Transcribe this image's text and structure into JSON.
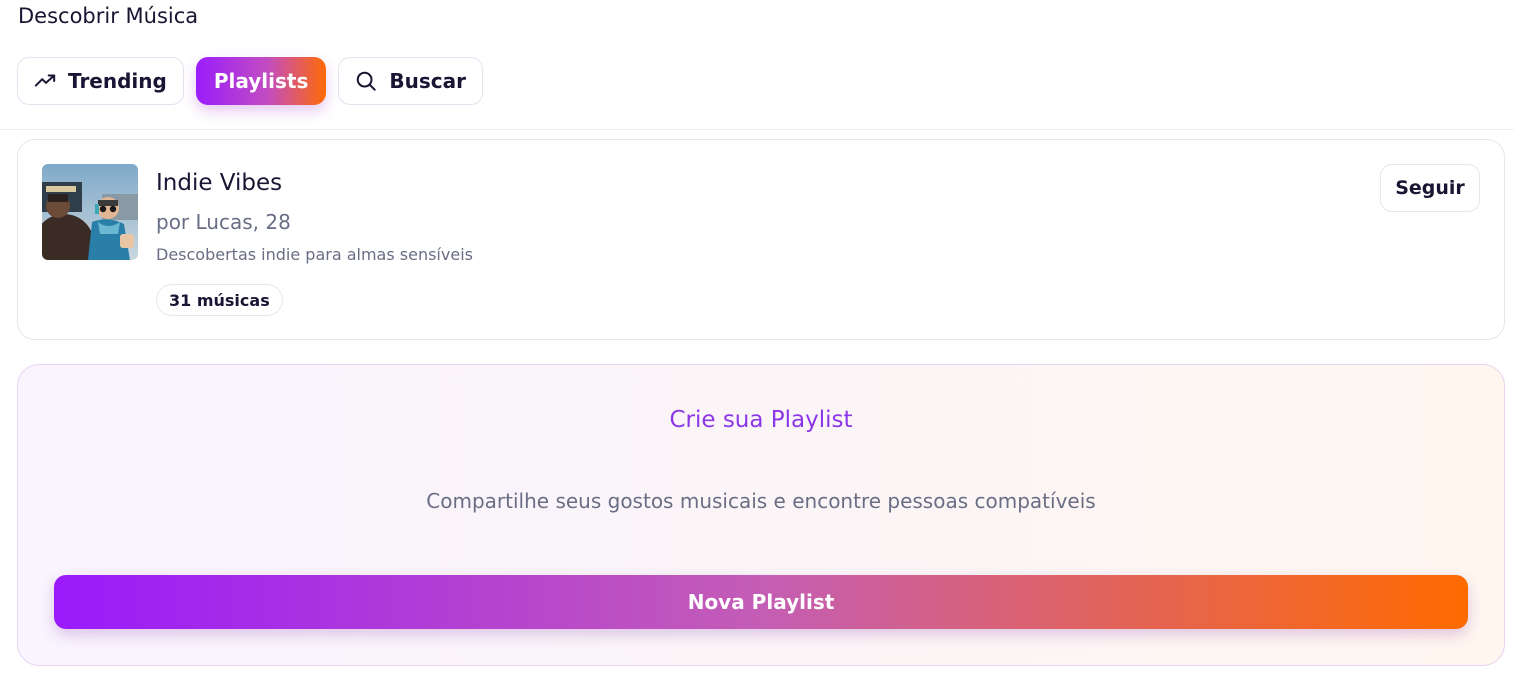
{
  "header": {
    "title": "Descobrir Música"
  },
  "tabs": [
    {
      "label": "Trending",
      "icon": "trending-up-icon",
      "active": false
    },
    {
      "label": "Playlists",
      "icon": "",
      "active": true
    },
    {
      "label": "Buscar",
      "icon": "search-icon",
      "active": false
    }
  ],
  "playlist": {
    "title": "Indie Vibes",
    "author": "por Lucas, 28",
    "description": "Descobertas indie para almas sensíveis",
    "track_count": "31 músicas",
    "follow_label": "Seguir",
    "cover_image": "concert-crowd-child-photo"
  },
  "create": {
    "title": "Crie sua Playlist",
    "subtitle": "Compartilhe seus gostos musicais e encontre pessoas compatíveis",
    "button_label": "Nova Playlist"
  },
  "colors": {
    "gradient_start": "#9a1dfb",
    "gradient_end": "#ff6a05",
    "accent_text": "#8c37e6",
    "muted_text": "#6a6e85",
    "primary_text": "#1c1433"
  }
}
